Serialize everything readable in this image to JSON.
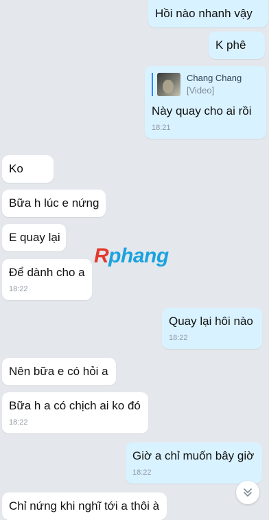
{
  "messages": [
    {
      "id": "m1",
      "side": "out",
      "text": "Hồi nào nhanh vậy"
    },
    {
      "id": "m2",
      "side": "out",
      "text": "K phê"
    },
    {
      "id": "m3",
      "side": "out",
      "quote": {
        "name": "Chang Chang",
        "type": "[Video]"
      },
      "text": "Này quay cho ai rồi",
      "time": "18:21"
    },
    {
      "id": "m4",
      "side": "in",
      "text": "Ko"
    },
    {
      "id": "m5",
      "side": "in",
      "text": "Bữa h lúc e nứng"
    },
    {
      "id": "m6",
      "side": "in",
      "text": "E quay lại"
    },
    {
      "id": "m7",
      "side": "in",
      "text": "Để dành cho a",
      "time": "18:22"
    },
    {
      "id": "m8",
      "side": "out",
      "text": "Quay lại hôi nào",
      "time": "18:22"
    },
    {
      "id": "m9",
      "side": "in",
      "text": "Nên bữa e có hỏi a"
    },
    {
      "id": "m10",
      "side": "in",
      "text": "Bữa h a có chịch ai ko đó",
      "time": "18:22"
    },
    {
      "id": "m11",
      "side": "out",
      "text": "Giờ a chỉ muốn bây giờ",
      "time": "18:22"
    },
    {
      "id": "m12",
      "side": "in",
      "text": "Chỉ nứng khi nghĩ tới a thôi à"
    }
  ],
  "watermark": {
    "first": "R",
    "rest": "phang"
  },
  "scroll_button": {
    "icon": "double-chevron-down-icon"
  },
  "colors": {
    "background": "#e4e7ec",
    "incoming": "#ffffff",
    "outgoing": "#d9f2ff",
    "quote_bar": "#2a8bf2"
  }
}
